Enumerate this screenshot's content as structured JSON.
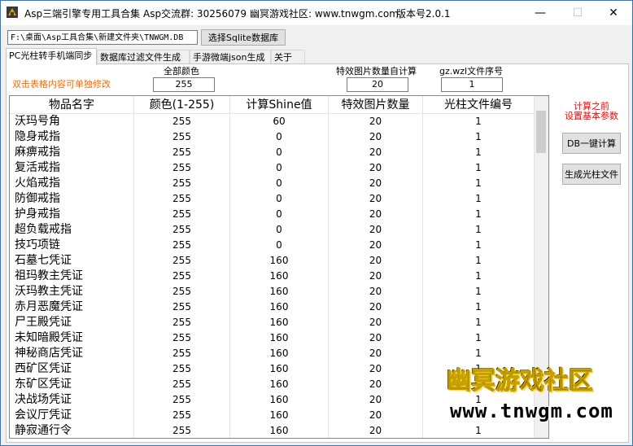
{
  "window": {
    "title_app": "Asp三端引擎专用工具合集",
    "title_group": "Asp交流群: 30256079",
    "title_site": "幽冥游戏社区: www.tnwgm.com",
    "title_version": "版本号2.0.1",
    "minimize": "—",
    "maximize": "☐",
    "close": "✕"
  },
  "toolbar": {
    "db_path": "F:\\桌面\\Asp工具合集\\新建文件夹\\TNWGM.DB",
    "select_db_label": "选择Sqlite数据库"
  },
  "tabs": [
    {
      "label": "PC光柱转手机端同步"
    },
    {
      "label": "数据库过滤文件生成"
    },
    {
      "label": "手游微端json生成"
    },
    {
      "label": "关于"
    }
  ],
  "panel": {
    "hint_left": "双击表格内容可单独修改",
    "all_color_label": "全部颜色",
    "all_color_value": "255",
    "effect_count_label": "特效图片数量自计算",
    "effect_count_value": "20",
    "wzl_label": "gz.wzl文件序号",
    "wzl_value": "1",
    "warning_line1": "计算之前",
    "warning_line2": "设置基本参数",
    "db_calc_button": "DB一键计算",
    "gen_file_button": "生成光柱文件"
  },
  "table": {
    "headers": [
      "物品名字",
      "颜色(1-255)",
      "计算Shine值",
      "特效图片数量",
      "光柱文件编号"
    ],
    "rows": [
      [
        "沃玛号角",
        "255",
        "60",
        "20",
        "1"
      ],
      [
        "隐身戒指",
        "255",
        "0",
        "20",
        "1"
      ],
      [
        "麻痹戒指",
        "255",
        "0",
        "20",
        "1"
      ],
      [
        "复活戒指",
        "255",
        "0",
        "20",
        "1"
      ],
      [
        "火焰戒指",
        "255",
        "0",
        "20",
        "1"
      ],
      [
        "防御戒指",
        "255",
        "0",
        "20",
        "1"
      ],
      [
        "护身戒指",
        "255",
        "0",
        "20",
        "1"
      ],
      [
        "超负载戒指",
        "255",
        "0",
        "20",
        "1"
      ],
      [
        "技巧项链",
        "255",
        "0",
        "20",
        "1"
      ],
      [
        "石墓七凭证",
        "255",
        "160",
        "20",
        "1"
      ],
      [
        "祖玛教主凭证",
        "255",
        "160",
        "20",
        "1"
      ],
      [
        "沃玛教主凭证",
        "255",
        "160",
        "20",
        "1"
      ],
      [
        "赤月恶魔凭证",
        "255",
        "160",
        "20",
        "1"
      ],
      [
        "尸王殿凭证",
        "255",
        "160",
        "20",
        "1"
      ],
      [
        "未知暗殿凭证",
        "255",
        "160",
        "20",
        "1"
      ],
      [
        "神秘商店凭证",
        "255",
        "160",
        "20",
        "1"
      ],
      [
        "西矿区凭证",
        "255",
        "160",
        "20",
        "1"
      ],
      [
        "东矿区凭证",
        "255",
        "160",
        "20",
        "1"
      ],
      [
        "决战场凭证",
        "255",
        "160",
        "20",
        "1"
      ],
      [
        "会议厅凭证",
        "255",
        "160",
        "20",
        "1"
      ],
      [
        "静寂通行令",
        "255",
        "160",
        "20",
        "1"
      ]
    ]
  },
  "watermark": {
    "cn": "幽冥游戏社区",
    "url": "www.tnwgm.com"
  },
  "colors": {
    "hint_orange": "#ff6a00",
    "warning_red": "#ff0000",
    "window_border": "#2b79c7"
  }
}
